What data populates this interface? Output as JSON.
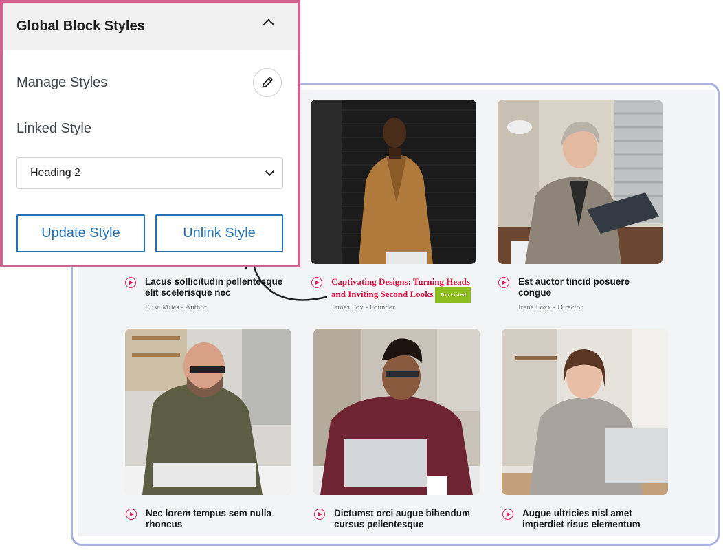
{
  "panel": {
    "title": "Global Block Styles",
    "manage_label": "Manage Styles",
    "linked_label": "Linked Style",
    "select_value": "Heading 2",
    "update_label": "Update Style",
    "unlink_label": "Unlink Style"
  },
  "cards": [
    {
      "title": "Lacus sollicitudin pellentesque elit scelerisque nec",
      "meta": "Elisa Miles - Author"
    },
    {
      "title": "Captivating Designs: Turning Heads and Inviting Second Looks",
      "badge": "Top Listed",
      "meta": "James Fox - Founder"
    },
    {
      "title": "Est auctor tincid posuere congue",
      "meta": "Irene Foxx - Director"
    },
    {
      "title": "Nec lorem tempus sem nulla rhoncus",
      "meta": ""
    },
    {
      "title": "Dictumst orci augue bibendum cursus pellentesque",
      "meta": ""
    },
    {
      "title": "Augue ultricies nisl amet imperdiet risus elementum",
      "meta": ""
    }
  ],
  "colors": {
    "accent_blue": "#2271b1",
    "panel_border": "#d1618f",
    "frame_border": "#aab2e4",
    "play_red": "#e21b5a",
    "badge_green": "#8bbd1f"
  }
}
